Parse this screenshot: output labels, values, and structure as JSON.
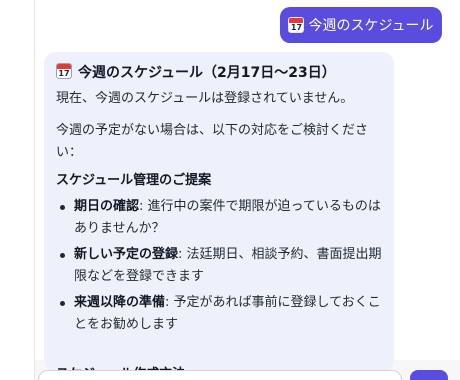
{
  "user_message": {
    "icon": "calendar-icon",
    "calendar_day": "17",
    "text": "今週のスケジュール"
  },
  "assistant_message": {
    "title_icon": "calendar-icon",
    "calendar_day": "17",
    "title": "今週のスケジュール（2月17日〜23日）",
    "status": "現在、今週のスケジュールは登録されていません。",
    "intro": "今週の予定がない場合は、以下の対応をご検討ください：",
    "section_heading": "スケジュール管理のご提案",
    "suggestions": [
      {
        "term": "期日の確認",
        "text": ": 進行中の案件で期限が迫っているものはありませんか？"
      },
      {
        "term": "新しい予定の登録",
        "text": ": 法廷期日、相談予約、書面提出期限などを登録できます"
      },
      {
        "term": "来週以降の準備",
        "text": ": 予定があれば事前に登録しておくことをお勧めします"
      }
    ],
    "next_heading": "スケジュール作成方法"
  },
  "colors": {
    "accent": "#5b4ce0",
    "assistant_bubble": "#eef0fb"
  }
}
